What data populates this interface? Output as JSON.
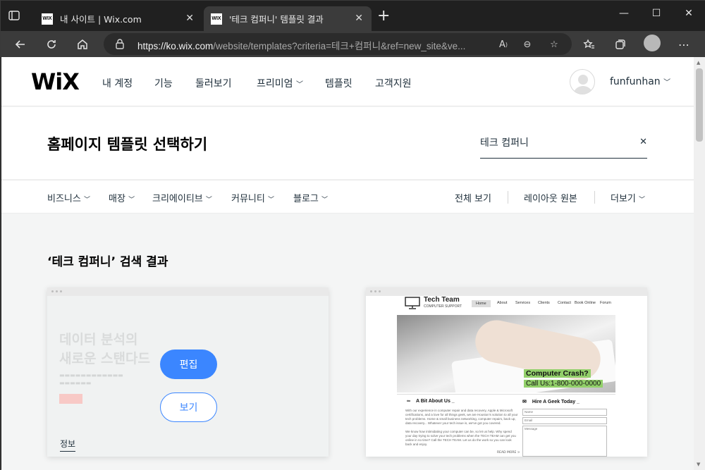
{
  "browser": {
    "tabs": [
      {
        "favicon": "WIX",
        "title": "내 사이트 | Wix.com"
      },
      {
        "favicon": "WIX",
        "title": "'테크 컴퍼니' 템플릿 결과"
      }
    ],
    "url_host": "https://ko.wix.com",
    "url_path": "/website/templates?criteria=테크+컴퍼니&ref=new_site&ve..."
  },
  "site": {
    "logo": "WiX",
    "nav": [
      "내 계정",
      "기능",
      "둘러보기",
      "프리미엄",
      "템플릿",
      "고객지원"
    ],
    "username": "funfunhan",
    "page_title": "홈페이지 템플릿 선택하기",
    "search_value": "테크 컴퍼니",
    "categories": [
      "비즈니스",
      "매장",
      "크리에이티브",
      "커뮤니티",
      "블로그"
    ],
    "right_links": [
      "전체 보기",
      "레이아웃 원본",
      "더보기"
    ],
    "results_title": "‘테크 컴퍼니’ 검색 결과"
  },
  "card1": {
    "headline_1": "데이터 분석의",
    "headline_2": "새로운 스탠다드",
    "edit": "편집",
    "view": "보기",
    "info": "정보"
  },
  "card2": {
    "name": "Tech Team",
    "tagline": "COMPUTER SUPPORT",
    "menu": [
      "Home",
      "About",
      "Services",
      "Clients",
      "Contact",
      "Book Online",
      "Forum"
    ],
    "crash": "Computer Crash?",
    "call": "Call Us:1-800-000-0000",
    "about_title": "A Bit About Us _",
    "hire_title": "Hire A Geek Today _",
    "about_p1": "With our experience in computer repair and data recovery, Apple & Microsoft certifications, and a love for all things geek, we are Houston's solution to all your tech problems. Home & small business networking, computer repairs, back up, data recovery... Whatever your tech issue is, we've got you covered.",
    "about_p2": "We know how intimidating your computer can be, so let us help. Why spend your day trying to solve your tech problems when the TECH TEAM can get you online in no time? Call the TECH TEAM. Let us do the work so you can look back and enjoy.",
    "fields": [
      "Name",
      "Email",
      "Message"
    ],
    "read_more": "READ MORE  >"
  }
}
